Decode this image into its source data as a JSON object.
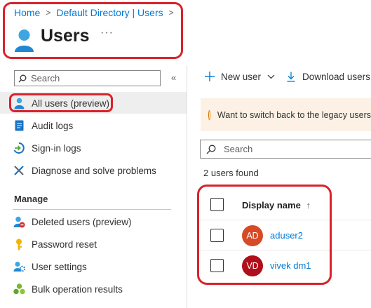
{
  "header": {
    "breadcrumb": [
      "Home",
      "Default Directory | Users"
    ],
    "title": "Users",
    "more": "···"
  },
  "nav": {
    "search_placeholder": "Search",
    "collapse": "«",
    "items": [
      {
        "label": "All users (preview)",
        "icon": "user-icon",
        "selected": true
      },
      {
        "label": "Audit logs",
        "icon": "audit-log-icon"
      },
      {
        "label": "Sign-in logs",
        "icon": "sign-in-icon"
      },
      {
        "label": "Diagnose and solve problems",
        "icon": "wrench-icon"
      }
    ],
    "section_label": "Manage",
    "manage_items": [
      {
        "label": "Deleted users (preview)",
        "icon": "deleted-user-icon"
      },
      {
        "label": "Password reset",
        "icon": "key-icon"
      },
      {
        "label": "User settings",
        "icon": "user-settings-icon"
      },
      {
        "label": "Bulk operation results",
        "icon": "bulk-results-icon"
      }
    ]
  },
  "toolbar": {
    "new_user": "New user",
    "download_users": "Download users"
  },
  "banner": {
    "text": "Want to switch back to the legacy users"
  },
  "main": {
    "search_placeholder": "Search",
    "found_text": "2 users found",
    "column_header": "Display name",
    "sort_indicator": "↑",
    "rows": [
      {
        "initials": "AD",
        "name": "aduser2",
        "avatar_color": "#d74a26"
      },
      {
        "initials": "VD",
        "name": "vivek dm1",
        "avatar_color": "#b00e1a"
      }
    ]
  },
  "colors": {
    "accent": "#0078d4",
    "highlight": "#d9222b",
    "banner_bg": "#fdf1e6"
  }
}
